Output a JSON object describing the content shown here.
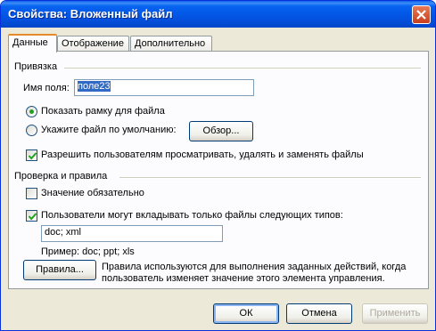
{
  "window": {
    "title": "Свойства: Вложенный файл"
  },
  "tabs": [
    {
      "label": "Данные"
    },
    {
      "label": "Отображение"
    },
    {
      "label": "Дополнительно"
    }
  ],
  "binding": {
    "group_title": "Привязка",
    "field_name_label": "Имя поля:",
    "field_name_value": "поле23",
    "radio_show_frame": "Показать рамку для файла",
    "radio_default_file": "Укажите файл по умолчанию:",
    "browse_button": "Обзор...",
    "allow_users_check": "Разрешить пользователям просматривать, удалять и заменять файлы"
  },
  "validation": {
    "group_title": "Проверка и правила",
    "required_check": "Значение обязательно",
    "types_check": "Пользователи могут вкладывать только файлы следующих типов:",
    "types_value": "doc; xml",
    "example_text": "Пример: doc; ppt; xls",
    "rules_button": "Правила...",
    "rules_desc_line1": "Правила используются для выполнения заданных действий, когда",
    "rules_desc_line2": "пользователь изменяет значение этого элемента управления."
  },
  "footer": {
    "ok": "ОК",
    "cancel": "Отмена",
    "apply": "Применить"
  }
}
